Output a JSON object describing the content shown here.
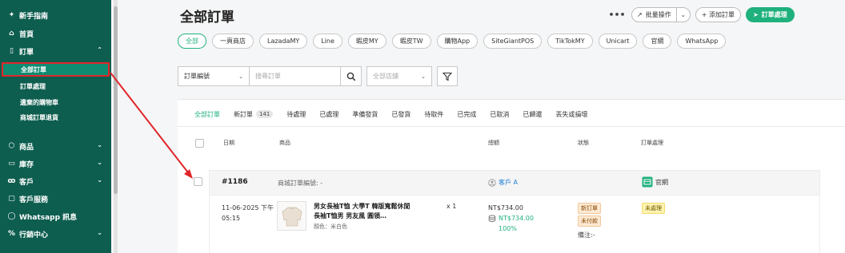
{
  "sidebar": {
    "items": [
      {
        "label": "新手指南",
        "icon": "spark-icon"
      },
      {
        "label": "首頁",
        "icon": "home-icon"
      },
      {
        "label": "訂單",
        "icon": "clipboard-icon"
      },
      {
        "label": "商品",
        "icon": "box-icon"
      },
      {
        "label": "庫存",
        "icon": "inventory-icon"
      },
      {
        "label": "客戶",
        "icon": "users-icon"
      },
      {
        "label": "客戶服務",
        "icon": "chat-icon"
      },
      {
        "label": "Whatsapp 訊息",
        "icon": "whatsapp-icon"
      },
      {
        "label": "行銷中心",
        "icon": "percent-icon"
      }
    ],
    "order_sub": [
      "全部訂單",
      "訂單處理",
      "遺棄的購物車",
      "商城訂單退貨"
    ]
  },
  "page": {
    "title": "全部訂單",
    "more": "•••",
    "bulk_label": "批量操作",
    "add_label": "+ 添加訂單",
    "process_label": "訂單處理"
  },
  "channels": [
    "全部",
    "一頁商店",
    "LazadaMY",
    "Line",
    "蝦皮MY",
    "蝦皮TW",
    "購物App",
    "SiteGiantPOS",
    "TikTokMY",
    "Unicart",
    "官網",
    "WhatsApp"
  ],
  "filters": {
    "field": "訂單編號",
    "search_placeholder": "搜尋訂單",
    "store": "全部店舖"
  },
  "tabs": [
    {
      "label": "全部訂單"
    },
    {
      "label": "新訂單",
      "count": "141"
    },
    {
      "label": "待處理"
    },
    {
      "label": "已處理"
    },
    {
      "label": "準備發貨"
    },
    {
      "label": "已發貨"
    },
    {
      "label": "待取件"
    },
    {
      "label": "已完成"
    },
    {
      "label": "已取消"
    },
    {
      "label": "已歸還"
    },
    {
      "label": "丟失或損壞"
    }
  ],
  "columns": {
    "date": "日期",
    "product": "商品",
    "total": "總額",
    "status": "狀態",
    "processing": "訂單處理"
  },
  "order": {
    "id": "#1186",
    "mall_no": "商城訂單編號: -",
    "customer": "客戶 A",
    "channel": "官網",
    "date_line1": "11-06-2025 下午",
    "date_line2": "05:15",
    "product_name": "男女長袖T恤 大學T 韓版寬鬆休閒長袖T恤男 男友風 圓領…",
    "variant": "顏色：米白色",
    "qty": "x 1",
    "total": "NT$734.00",
    "paid": "NT$734.00",
    "paid_pct": "100%",
    "status_new": "新訂單",
    "status_unpaid": "未付款",
    "note": "備注:-",
    "processing": "未處理"
  },
  "colors": {
    "sidebar_bg": "#0d5e4f",
    "sidebar_active": "#0f8b72",
    "accent": "#1fb17d",
    "annotation": "#e0262a"
  }
}
